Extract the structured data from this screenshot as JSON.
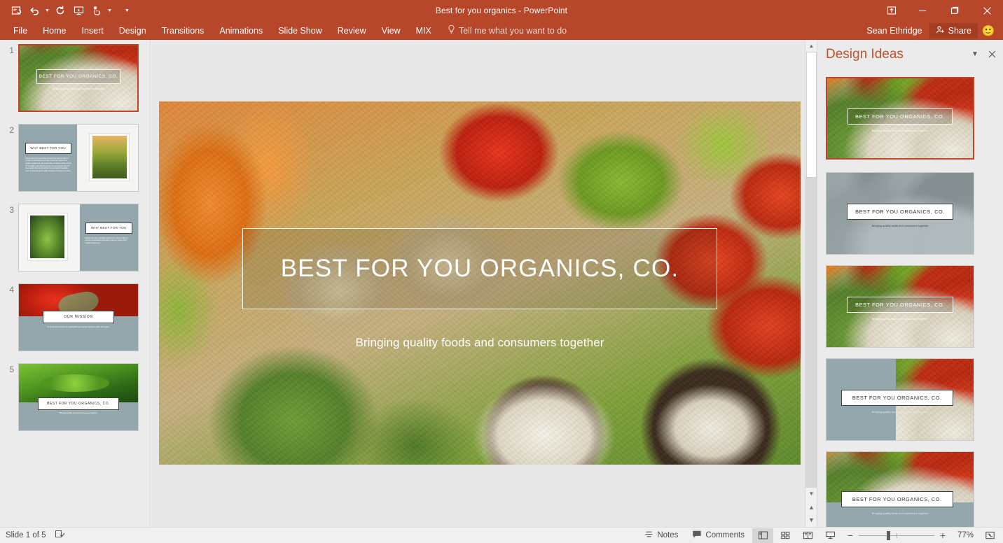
{
  "window": {
    "title": "Best for you organics - PowerPoint",
    "user": "Sean Ethridge",
    "share_label": "Share",
    "minimize": "minimize-icon",
    "maximize": "maximize-icon",
    "close": "close-icon",
    "ribbon_display_options": "ribbon-display-options-icon",
    "accent_color": "#b7472a",
    "share_bg": "#a23d22"
  },
  "qat": {
    "items": [
      {
        "name": "save-sync-icon",
        "caret": false
      },
      {
        "name": "undo-icon",
        "caret": true
      },
      {
        "name": "redo-icon",
        "caret": false
      },
      {
        "name": "start-from-beginning-icon",
        "caret": false
      },
      {
        "name": "touch-mouse-mode-icon",
        "caret": true
      },
      {
        "name": "customize-quick-access-toolbar-icon",
        "caret": false
      }
    ]
  },
  "ribbon": {
    "tabs": [
      "File",
      "Home",
      "Insert",
      "Design",
      "Transitions",
      "Animations",
      "Slide Show",
      "Review",
      "View",
      "MIX"
    ],
    "tellme_placeholder": "Tell me what you want to do",
    "tellme_icon": "lightbulb-icon"
  },
  "slide_panel": {
    "slides": [
      {
        "number": "1",
        "title": "BEST FOR YOU ORGANICS, CO.",
        "subtitle": "Bringing quality foods and consumers together",
        "layout": "photo-full",
        "selected": true
      },
      {
        "number": "2",
        "title": "WHY BEST FOR YOU",
        "subtitle": "Buying fruits and vegetables directly from farmers offers a number of advantages and often means an organic food supplier weighs less; the excess fat a consumer who is paying for a headline also with fermented processed foods than for the organic offers and is all the more and grains available crops of what are grown while choosing crop from our source.",
        "layout": "slate-left-photo-right",
        "selected": false
      },
      {
        "number": "3",
        "title": "WHY BEST FOR YOU",
        "subtitle": "Buying fruits and vegetables directly from farmers offers a number of advantages and often means an organic food supplier weighs less.",
        "layout": "photo-left-slate-right",
        "selected": false
      },
      {
        "number": "4",
        "title": "OUR MISSION",
        "subtitle": "To be the best source of sustainable and organic produce within the region.",
        "layout": "photo-top-slate-bottom",
        "selected": false
      },
      {
        "number": "5",
        "title": "BEST FOR YOU ORGANICS, CO.",
        "subtitle": "Bringing quality food and consumers together",
        "layout": "photo-top-slate-bottom",
        "selected": false
      }
    ]
  },
  "slide": {
    "title": "BEST FOR YOU ORGANICS, CO.",
    "subtitle": "Bringing quality foods and consumers together"
  },
  "design_ideas": {
    "heading": "Design Ideas",
    "collapse_icon": "chevron-down-icon",
    "close_icon": "close-icon",
    "cards": [
      {
        "title": "BEST FOR YOU ORGANICS, CO.",
        "subtitle": "Bringing quality foods and consumers together",
        "style": "photo-outline-box",
        "selected": true
      },
      {
        "title": "BEST FOR YOU ORGANICS, CO.",
        "subtitle": "Bringing quality foods and consumers together",
        "style": "gray-photo-white-box",
        "selected": false
      },
      {
        "title": "BEST FOR YOU ORGANICS, CO.",
        "subtitle": "Bringing quality foods and consumers together",
        "style": "photo-outline-box",
        "selected": false
      },
      {
        "title": "BEST FOR YOU ORGANICS, CO.",
        "subtitle": "Bringing quality foods and consumers together",
        "style": "slate-left-photo-right",
        "selected": false
      },
      {
        "title": "BEST FOR YOU ORGANICS, CO.",
        "subtitle": "Bringing quality foods and consumers together",
        "style": "photo-top-slate-bottom",
        "selected": false
      }
    ]
  },
  "status_bar": {
    "slide_counter": "Slide 1 of 5",
    "accessibility_icon": "accessibility-checker-icon",
    "notes_label": "Notes",
    "notes_icon": "notes-icon",
    "comments_label": "Comments",
    "comments_icon": "comments-icon",
    "views": [
      {
        "name": "normal-view-button",
        "active": true
      },
      {
        "name": "slide-sorter-view-button",
        "active": false
      },
      {
        "name": "reading-view-button",
        "active": false
      },
      {
        "name": "slide-show-button",
        "active": false
      }
    ],
    "zoom_out": "−",
    "zoom_in": "+",
    "zoom_level": "77%",
    "fit_to_window_icon": "fit-slide-to-window-icon"
  }
}
